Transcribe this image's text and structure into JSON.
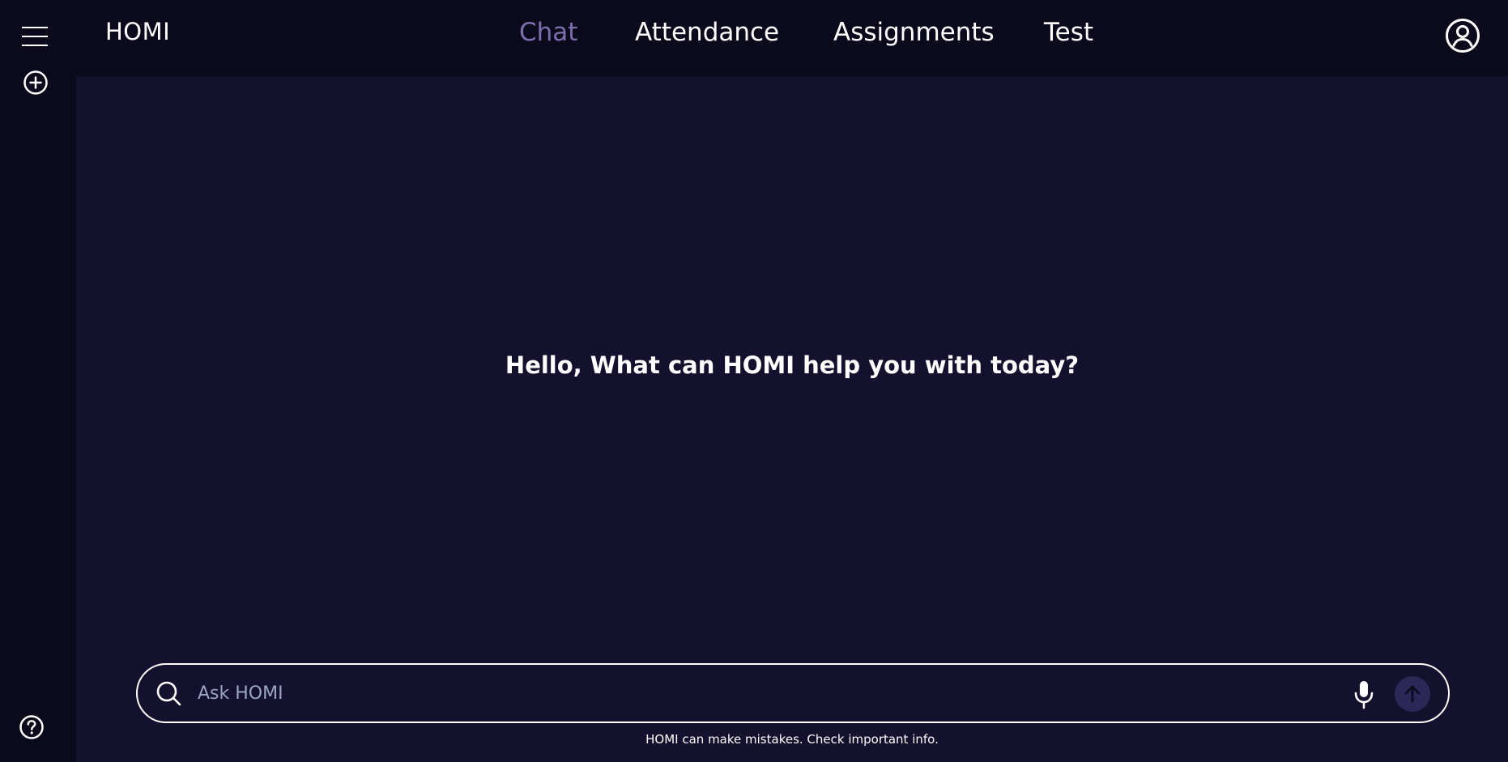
{
  "app": {
    "name": "HOMI"
  },
  "colors": {
    "background": "#0b0a1c",
    "panel": "#13112d",
    "active_tab": "#7d6fae",
    "placeholder": "#9aa6c4",
    "send_button": "#2c2757"
  },
  "sidebar": {
    "icons": [
      "menu-icon",
      "plus-circle-icon",
      "help-circle-icon"
    ]
  },
  "nav": {
    "tabs": [
      {
        "label": "Chat",
        "active": true
      },
      {
        "label": "Attendance",
        "active": false
      },
      {
        "label": "Assignments",
        "active": false
      },
      {
        "label": "Test",
        "active": false
      }
    ],
    "profile_icon": "user-circle-icon"
  },
  "main": {
    "greeting": "Hello, What can HOMI help you with today?",
    "input": {
      "placeholder": "Ask HOMI",
      "value": "",
      "icons": [
        "search-icon",
        "microphone-icon",
        "arrow-up-icon"
      ]
    },
    "disclaimer": "HOMI can make mistakes. Check important info."
  }
}
